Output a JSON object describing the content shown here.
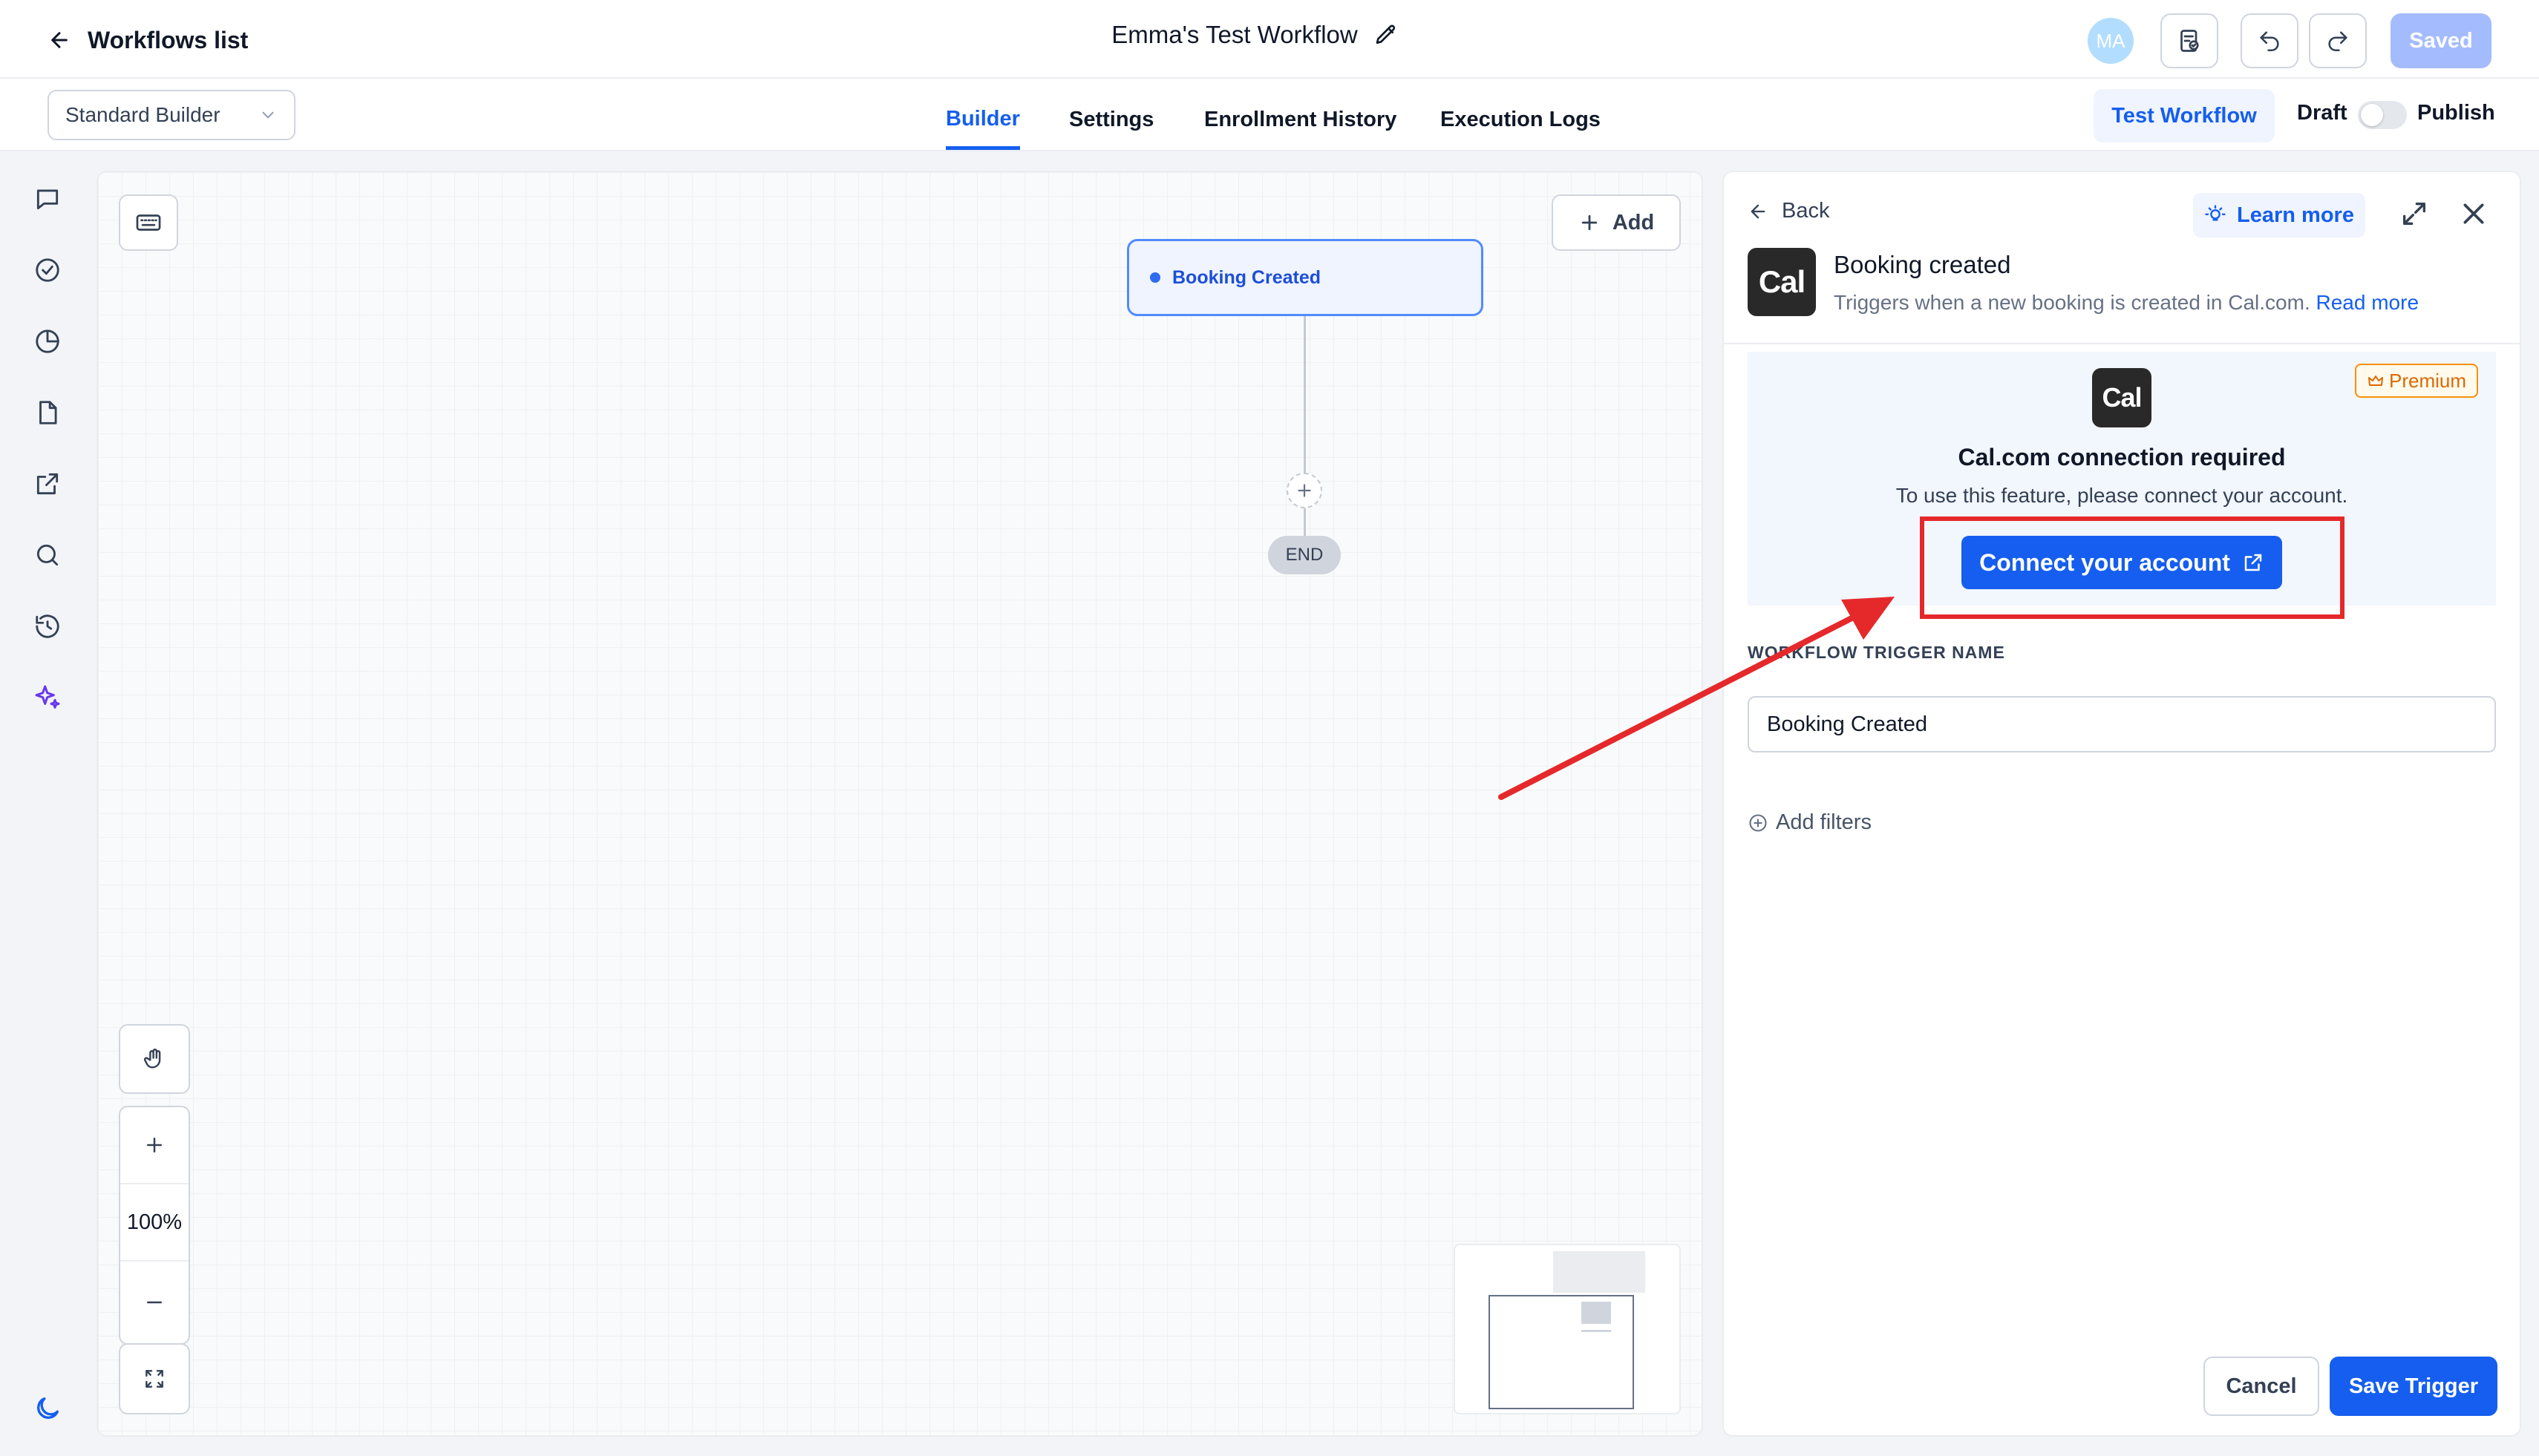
{
  "header": {
    "back_label": "Workflows list",
    "workflow_title": "Emma's Test Workflow",
    "avatar_initials": "MA",
    "saved_label": "Saved"
  },
  "subbar": {
    "builder_mode": "Standard Builder",
    "tabs": [
      {
        "label": "Builder",
        "active": true
      },
      {
        "label": "Settings",
        "active": false
      },
      {
        "label": "Enrollment History",
        "active": false
      },
      {
        "label": "Execution Logs",
        "active": false
      }
    ],
    "test_label": "Test Workflow",
    "draft_label": "Draft",
    "publish_label": "Publish"
  },
  "canvas": {
    "add_label": "Add",
    "trigger_node_label": "Booking Created",
    "end_label": "END",
    "zoom_level": "100%"
  },
  "panel": {
    "back_label": "Back",
    "learn_more_label": "Learn more",
    "logo_text": "Cal",
    "trigger_title": "Booking created",
    "trigger_description": "Triggers when a new booking is created in Cal.com.",
    "read_more_label": "Read more",
    "premium_label": "Premium",
    "connection_title": "Cal.com connection required",
    "connection_subtitle": "To use this feature, please connect your account.",
    "connect_label": "Connect your account",
    "field_label": "WORKFLOW TRIGGER NAME",
    "field_value": "Booking Created",
    "add_filters_label": "Add filters",
    "cancel_label": "Cancel",
    "save_label": "Save Trigger"
  },
  "colors": {
    "accent": "#155eef",
    "annotation": "#e5292b",
    "premium": "#dc6803"
  },
  "icons": {
    "rail": [
      "chat-icon",
      "check-circle-icon",
      "pie-chart-icon",
      "document-icon",
      "external-link-icon",
      "search-icon",
      "history-icon",
      "sparkle-icon",
      "moon-icon"
    ]
  }
}
